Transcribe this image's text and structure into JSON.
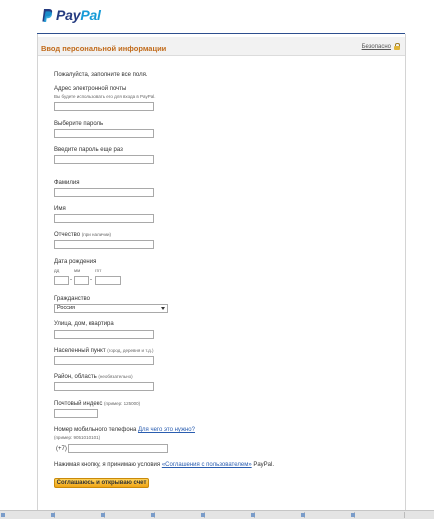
{
  "brand": {
    "name_part1": "Pay",
    "name_part2": "Pal"
  },
  "header": {
    "title": "Ввод персональной информации",
    "secure_label": "Безопасно"
  },
  "form": {
    "intro": "Пожалуйста, заполните все поля.",
    "email_label": "Адрес электронной почты",
    "email_hint": "Вы будете использовать его для входа в PayPal.",
    "password_label": "Выберите пароль",
    "password_confirm_label": "Введите пароль еще раз",
    "last_name_label": "Фамилия",
    "first_name_label": "Имя",
    "middle_name_label": "Отчество",
    "middle_name_hint": "(при наличии)",
    "birth_date_label": "Дата рождения",
    "birth_day_hint": "дд",
    "birth_month_hint": "мм",
    "birth_year_hint": "гггг",
    "citizenship_label": "Гражданство",
    "citizenship_value": "Россия",
    "street_label": "Улица, дом, квартира",
    "city_label": "Населенный пункт",
    "city_hint": "(город, деревня и т.д.)",
    "region_label": "Район, область",
    "region_hint": "(необязательно)",
    "postal_label": "Почтовый индекс",
    "postal_hint": "(пример: 125000)",
    "mobile_label": "Номер мобильного телефона",
    "mobile_why_link": "Для чего это нужно?",
    "mobile_example": "(пример: 9051010101)",
    "mobile_prefix": "(+7)",
    "agreement_prefix": "Нажимая кнопку, я принимаю условия",
    "agreement_link": "«Соглашения с пользователем»",
    "agreement_suffix": "PayPal.",
    "submit_label": "Соглашаюсь и открываю счет"
  }
}
